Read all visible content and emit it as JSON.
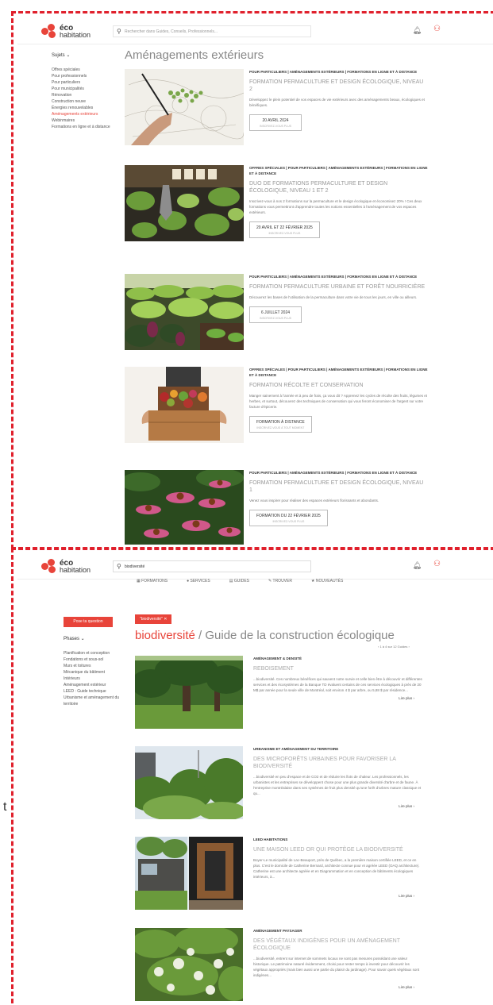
{
  "colors": {
    "accent": "#e8443a",
    "dashed_border": "#e0202c"
  },
  "stray_text": "t",
  "header": {
    "logo_line1": "éco",
    "logo_line2": "habitation",
    "search_placeholder": "Rechercher dans Guides, Conseils, Professionnels...",
    "search2_value": "biodiversité",
    "bell_icon": "bell-icon",
    "user_icon": "user-icon"
  },
  "page1": {
    "sidebar_head": "Sujets ⌄",
    "sidebar_items": [
      "Offres spéciales",
      "Pour professionnels",
      "Pour particuliers",
      "Pour municipalités",
      "Rénovation",
      "Construction neuve",
      "Énergies renouvelables",
      "Aménagements extérieurs",
      "Webinmaires",
      "Formations en ligne et à distance"
    ],
    "title": "Aménagements extérieurs",
    "cards": [
      {
        "cat": "POUR PARTICULIERS | AMÉNAGEMENTS EXTÉRIEURS | FORMATIONS EN LIGNE ET À DISTANCE",
        "title": "FORMATION PERMACULTURE ET DESIGN ÉCOLOGIQUE, NIVEAU 2",
        "desc": "Développez le plein potentiel de vos espaces de vie extérieurs avec des aménagements beaux, écologiques et bénéfiques.",
        "date": "20 AVRIL 2024",
        "sub": "INSCRIVEZ-VOUS PLUS"
      },
      {
        "cat": "OFFRES SPÉCIALES | POUR PARTICULIERS | AMÉNAGEMENTS EXTÉRIEURS | FORMATIONS EN LIGNE ET À DISTANCE",
        "title": "DUO DE FORMATIONS PERMACULTURE ET DESIGN ÉCOLOGIQUE, NIVEAU 1 ET 2",
        "desc": "Inscrivez-vous à nos 2 formations sur la permaculture et le design écologique et économisez 20% ! Ces deux formations vous permettront d'apprendre toutes les notions essentielles à l'aménagement de vos espaces extérieurs.",
        "date": "20 AVRIL ET 22 FÉVRIER 2025",
        "sub": "INSCRIVEZ-VOUS PLUS"
      },
      {
        "cat": "POUR PARTICULIERS | AMÉNAGEMENTS EXTÉRIEURS | FORMATIONS EN LIGNE ET À DISTANCE",
        "title": "FORMATION PERMACULTURE URBAINE ET FORÊT NOURRICIÈRE",
        "desc": "Découvrez les bases de l'utilisation de la permaculture dans votre vie de tous les jours, en ville ou ailleurs.",
        "date": "6 JUILLET 2024",
        "sub": "INSCRIVEZ-VOUS PLUS"
      },
      {
        "cat": "OFFRES SPÉCIALES | POUR PARTICULIERS | AMÉNAGEMENTS EXTÉRIEURS | FORMATIONS EN LIGNE ET À DISTANCE",
        "title": "FORMATION RÉCOLTE ET CONSERVATION",
        "desc": "Manger sainement à l'année et à peu de frais, ça vous dit ? Apprenez les cycles de récolte des fruits, légumes et herbes, et surtout, découvrez des techniques de conservation qui vous feront économiser de l'argent sur votre facture d'épicerie.",
        "date": "FORMATION À DISTANCE",
        "sub": "INSCRIVEZ-VOUS À TOUT MOMENT"
      },
      {
        "cat": "POUR PARTICULIERS | AMÉNAGEMENTS EXTÉRIEURS | FORMATIONS EN LIGNE ET À DISTANCE",
        "title": "FORMATION PERMACULTURE ET DESIGN ÉCOLOGIQUE, NIVEAU 1",
        "desc": "Venez vous inspirer pour réaliser des espaces extérieurs florissants et abondants.",
        "date": "FORMATION DU 22 FÉVRIER 2025",
        "sub": "INSCRIVEZ-VOUS PLUS"
      }
    ]
  },
  "page2": {
    "nav": [
      "FORMATIONS",
      "SERVICES",
      "GUIDES",
      "TROUVER",
      "NOUVEAUTÉS"
    ],
    "cta": "Pose ta question",
    "tag": "\"biodiversité\" ✕",
    "title_strong": "biodiversité",
    "title_rest": " / Guide de la construction écologique",
    "pager": "‹ 1 à 4 sur 12 Guides ›",
    "sidebar_head": "Phases ⌄",
    "sidebar_items": [
      "Planification et conception",
      "Fondations et sous-sol",
      "Murs et toitures",
      "Mécanique du bâtiment",
      "Intérieurs",
      "Aménagement extérieur",
      "LEED : Guide technique",
      "Urbanisme et aménagement du territoire"
    ],
    "more_label": "Lire plus ›",
    "cards": [
      {
        "cat": "AMÉNAGEMENT & DENSITÉ",
        "title": "REBOISEMENT",
        "desc": "...biodiversité. Ces nombreux bénéfices qui sauvent notre survie et celle bien être à découvrir et différentes services et des écosystèmes de la Banque TD évaluent certains de ces services écologiques à près de 20 M$ par année pour la seule ville de Montréal, soit environ 4 $ par arbre, ou 5,88 $ par résidence..."
      },
      {
        "cat": "URBANISME ET AMÉNAGEMENT DU TERRITOIRE",
        "title": "DES MICROFORÊTS URBAINES POUR FAVORISER LA BIODIVERSITÉ",
        "desc": "...biodiversité en peu d'espace et de CO2 et de réduire les îlots de chaleur. Les professionnels, les urbanistes et les entreprises se développent chose pour une plus grande diversité d'arbre et de faune. À l'entreprise montréalaise dans ses systèmes de fruit plus densité qu'une forêt d'arbres mature classique et qu..."
      },
      {
        "cat": "LEED HABITATIONS",
        "title": "UNE MAISON LEED OR QUI PROTÈGE LA BIODIVERSITÉ",
        "desc": "Boyer-Le municipalité de Lac-Beauport, près de Québec, a la première maison certifiée LEED, et ce en plus. C'est le domicile de Catherine Bernard, architecte connue pour et agréée LEED (OAQ architecture). Catherine est une architecte agréée et en Diagrammation et en conception de bâtiments écologiques intérieurs, à..."
      },
      {
        "cat": "AMÉNAGEMENT PAYSAGER",
        "title": "DES VÉGÉTAUX INDIGÈNES POUR UN AMÉNAGEMENT ÉCOLOGIQUE",
        "desc": "...biodiversité, entrent sur internet de sommets locaux ne sont pas mesures possédant une valeur historique. Le patrimoine naturel évidemment, choisi pour rester temps à investir pour découvrir les végétaux appropriés (mais bien aussi une partie du plaisir du jardinage). Pour savoir quels végétaux sont indigènes..."
      }
    ]
  }
}
